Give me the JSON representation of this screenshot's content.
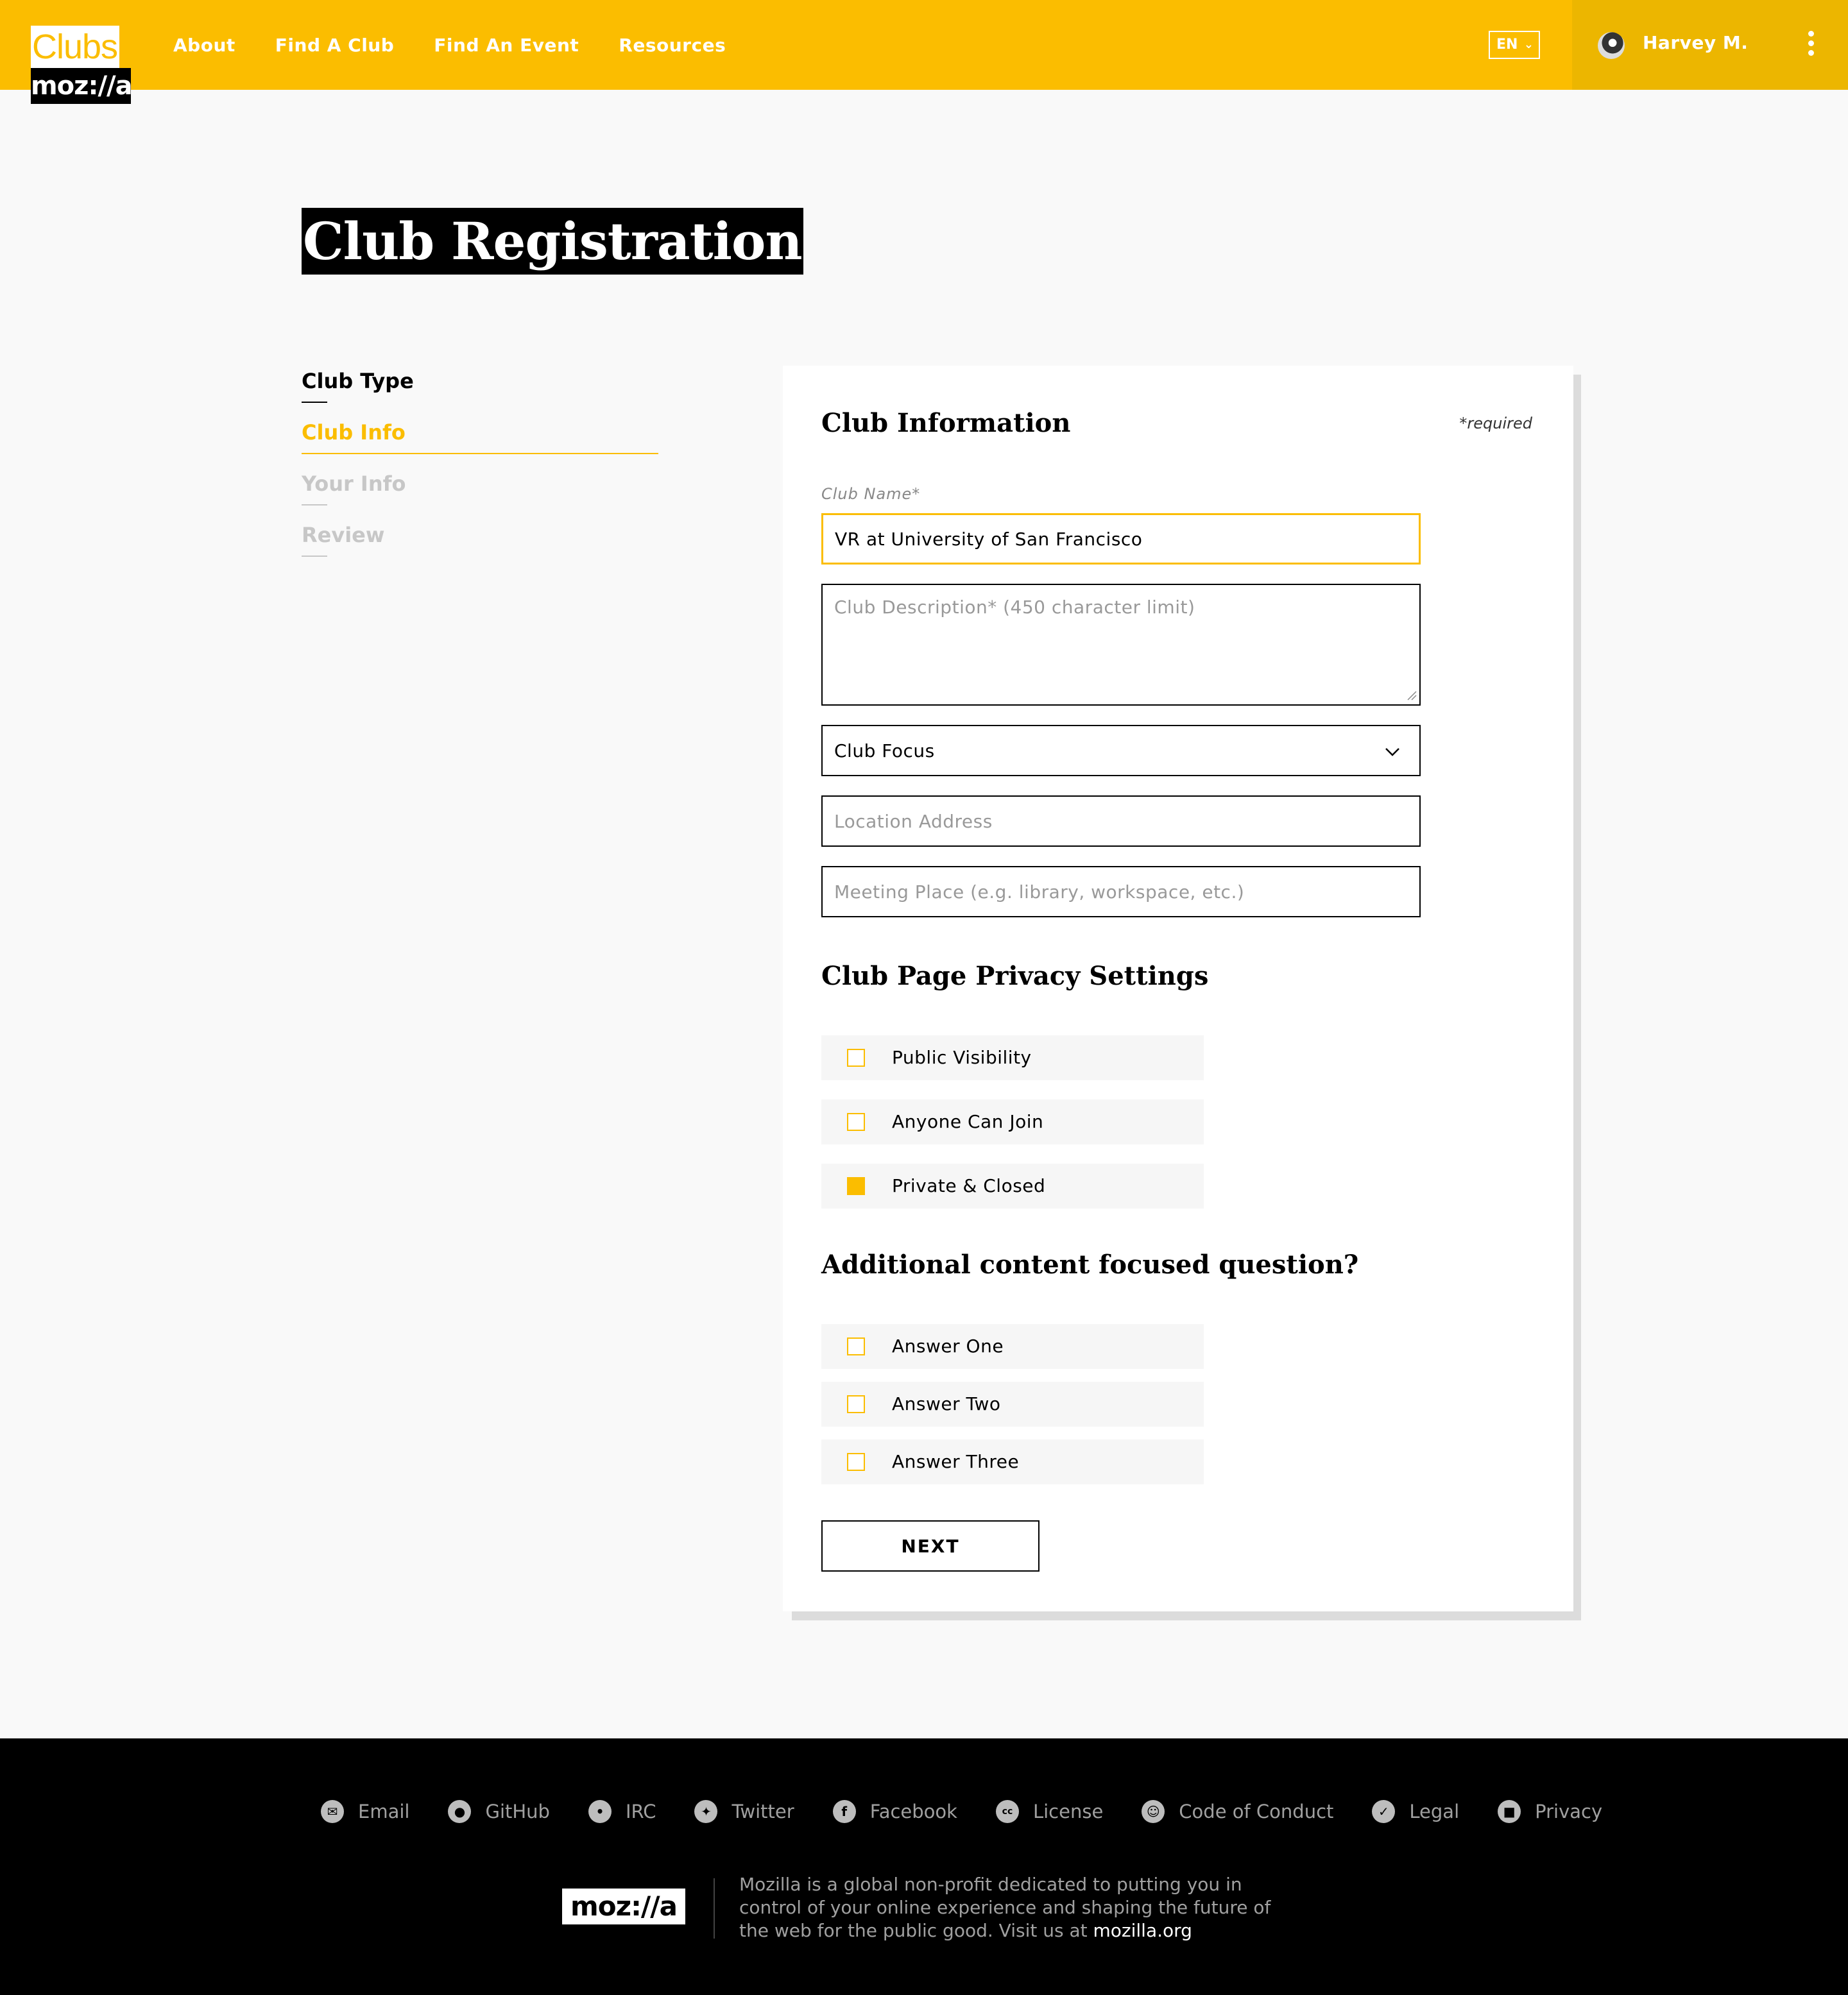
{
  "header": {
    "logo_top": "Clubs",
    "logo_bottom": "moz://a",
    "nav": [
      "About",
      "Find A Club",
      "Find An Event",
      "Resources"
    ],
    "language": "EN",
    "user_name": "Harvey M."
  },
  "page_title": "Club Registration",
  "steps": [
    {
      "label": "Club Type",
      "state": "done"
    },
    {
      "label": "Club Info",
      "state": "active"
    },
    {
      "label": "Your Info",
      "state": "inactive"
    },
    {
      "label": "Review",
      "state": "inactive"
    }
  ],
  "form": {
    "title": "Club Information",
    "required_note": "*required",
    "club_name_label": "Club Name*",
    "club_name_value": "VR at University of San Francisco",
    "description_placeholder": "Club Description* (450 character limit)",
    "focus_selected": "Club Focus",
    "location_placeholder": "Location Address",
    "meeting_placeholder": "Meeting Place (e.g. library, workspace, etc.)",
    "privacy_title": "Club Page Privacy Settings",
    "privacy_options": [
      {
        "label": "Public Visibility",
        "checked": false
      },
      {
        "label": "Anyone Can Join",
        "checked": false
      },
      {
        "label": "Private & Closed",
        "checked": true
      }
    ],
    "question_title": "Additional content focused question?",
    "answers": [
      {
        "label": "Answer One",
        "checked": false
      },
      {
        "label": "Answer Two",
        "checked": false
      },
      {
        "label": "Answer Three",
        "checked": false
      }
    ],
    "next_label": "NEXT"
  },
  "footer": {
    "links": [
      {
        "label": "Email",
        "icon": "email-icon"
      },
      {
        "label": "GitHub",
        "icon": "github-icon"
      },
      {
        "label": "IRC",
        "icon": "chat-icon"
      },
      {
        "label": "Twitter",
        "icon": "twitter-icon"
      },
      {
        "label": "Facebook",
        "icon": "facebook-icon"
      },
      {
        "label": "License",
        "icon": "cc-license-icon"
      },
      {
        "label": "Code of Conduct",
        "icon": "smiley-icon"
      },
      {
        "label": "Legal",
        "icon": "checkmark-icon"
      },
      {
        "label": "Privacy",
        "icon": "lock-icon"
      }
    ],
    "logo": "moz://a",
    "text": "Mozilla is a global non-profit dedicated to putting you in control of your online experience and shaping the future of the web for the public good. Visit us at",
    "org_link": "mozilla.org"
  },
  "colors": {
    "accent": "#fbbd00",
    "accent_dark": "#ecb600",
    "footer_bg": "#000000"
  }
}
